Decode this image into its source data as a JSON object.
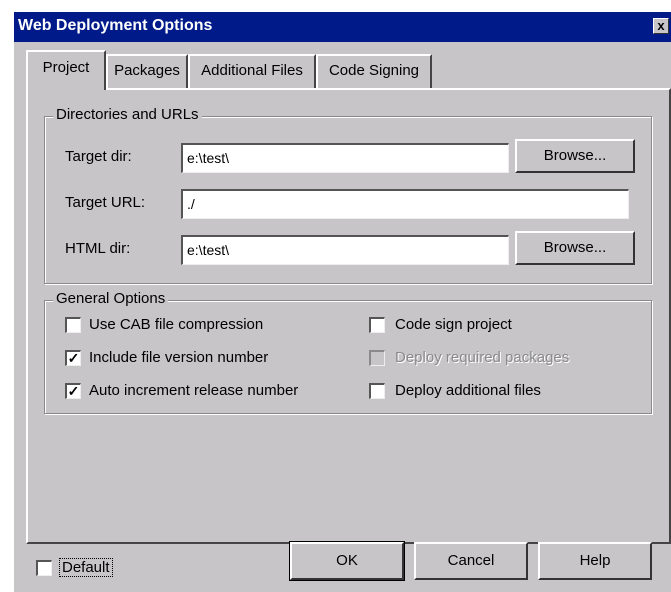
{
  "window": {
    "title": "Web Deployment Options",
    "close_glyph": "x"
  },
  "tabs": [
    {
      "label": "Project",
      "active": true
    },
    {
      "label": "Packages",
      "active": false
    },
    {
      "label": "Additional Files",
      "active": false
    },
    {
      "label": "Code Signing",
      "active": false
    }
  ],
  "directories": {
    "group_title": "Directories and URLs",
    "target_dir": {
      "label": "Target dir:",
      "value": "e:\\test\\",
      "browse_label": "Browse..."
    },
    "target_url": {
      "label": "Target URL:",
      "value": "./"
    },
    "html_dir": {
      "label": "HTML dir:",
      "value": "e:\\test\\",
      "browse_label": "Browse..."
    }
  },
  "general": {
    "group_title": "General Options",
    "options": [
      {
        "label": "Use CAB file compression",
        "checked": false,
        "enabled": true
      },
      {
        "label": "Include file version number",
        "checked": true,
        "enabled": true
      },
      {
        "label": "Auto increment release number",
        "checked": true,
        "enabled": true
      },
      {
        "label": "Code sign project",
        "checked": false,
        "enabled": true
      },
      {
        "label": "Deploy required packages",
        "checked": false,
        "enabled": false
      },
      {
        "label": "Deploy additional files",
        "checked": false,
        "enabled": true
      }
    ]
  },
  "footer": {
    "default_label": "Default",
    "default_checked": false,
    "ok_label": "OK",
    "cancel_label": "Cancel",
    "help_label": "Help"
  },
  "colors": {
    "titlebar": "#001a8a",
    "face": "#c7c5c8",
    "disabled_text": "#8a8a8a"
  },
  "check_glyph": "✓"
}
